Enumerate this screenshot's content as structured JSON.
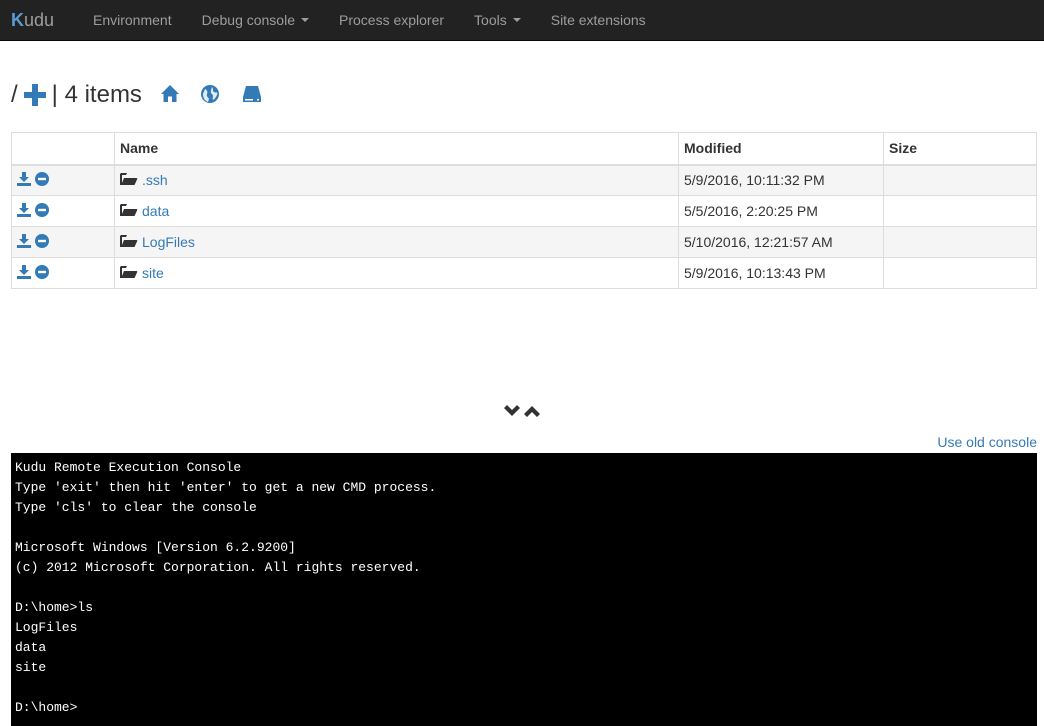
{
  "navbar": {
    "brand": "udu",
    "brand_k": "K",
    "items": [
      {
        "label": "Environment",
        "dropdown": false
      },
      {
        "label": "Debug console",
        "dropdown": true
      },
      {
        "label": "Process explorer",
        "dropdown": false
      },
      {
        "label": "Tools",
        "dropdown": true
      },
      {
        "label": "Site extensions",
        "dropdown": false
      }
    ]
  },
  "header": {
    "slash": "/",
    "count": "| 4 items"
  },
  "table": {
    "columns": [
      "",
      "Name",
      "Modified",
      "Size"
    ],
    "rows": [
      {
        "name": ".ssh",
        "modified": "5/9/2016, 10:11:32 PM",
        "size": ""
      },
      {
        "name": "data",
        "modified": "5/5/2016, 2:20:25 PM",
        "size": ""
      },
      {
        "name": "LogFiles",
        "modified": "5/10/2016, 12:21:57 AM",
        "size": ""
      },
      {
        "name": "site",
        "modified": "5/9/2016, 10:13:43 PM",
        "size": ""
      }
    ]
  },
  "old_console_label": "Use old console",
  "console": {
    "lines": [
      "Kudu Remote Execution Console",
      "Type 'exit' then hit 'enter' to get a new CMD process.",
      "Type 'cls' to clear the console",
      "",
      "Microsoft Windows [Version 6.2.9200]",
      "(c) 2012 Microsoft Corporation. All rights reserved.",
      "",
      "D:\\home>ls",
      "LogFiles",
      "data",
      "site",
      "",
      "D:\\home>"
    ]
  },
  "colors": {
    "link": "#337ab7",
    "navbar_bg": "#222222",
    "navbar_text": "#9d9d9d",
    "console_bg": "#000000"
  }
}
